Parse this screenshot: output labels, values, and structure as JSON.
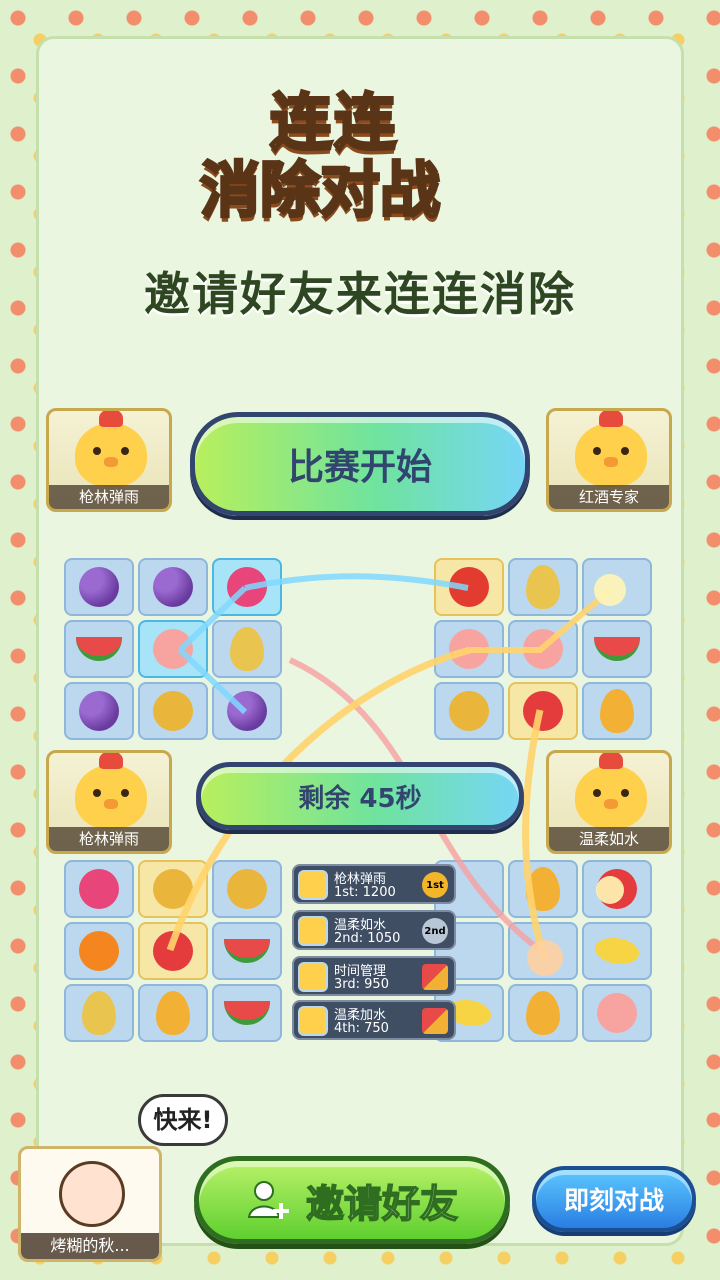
{
  "logo": {
    "line1": "连连",
    "line2a": "消除",
    "line2b": "对战"
  },
  "subtitle": "邀请好友来连连消除",
  "start_button": "比赛开始",
  "timer_button": "剩余 45秒",
  "players": {
    "top_left": "枪林弹雨",
    "top_right": "红酒专家",
    "mid_left": "枪林弹雨",
    "mid_right": "温柔如水"
  },
  "board_top_left": [
    "grapes",
    "grapes",
    "dragonfruit",
    "watermelon",
    "peach",
    "pear",
    "grapes",
    "pineapple",
    "grapes"
  ],
  "board_top_right": [
    "apple",
    "pear",
    "",
    "peach",
    "peach",
    "watermelon",
    "pineapple",
    "strawberry",
    "mango"
  ],
  "board_bottom_left": [
    "dragonfruit",
    "pineapple",
    "pineapple",
    "orange",
    "strawberry",
    "watermelon",
    "pear",
    "mango",
    "watermelon"
  ],
  "board_bottom_right": [
    "",
    "mango",
    "strawberry",
    "",
    "",
    "banana",
    "banana",
    "mango",
    "peach"
  ],
  "leaderboard": [
    {
      "name": "枪林弹雨",
      "score": "1st: 1200",
      "medal": "1st"
    },
    {
      "name": "温柔如水",
      "score": "2nd: 1050",
      "medal": "2nd"
    },
    {
      "name": "时间管理",
      "score": "3rd: 950",
      "medal": ""
    },
    {
      "name": "温柔加水",
      "score": "4th: 750",
      "medal": ""
    }
  ],
  "bubble": "快来!",
  "me_label": "烤糊的秋...",
  "invite_button": "邀请好友",
  "fight_button": "即刻对战",
  "colors": {
    "grapes": "#7b4bb5",
    "dragonfruit": "#e8457a",
    "watermelon": "#e84a4a",
    "peach": "#f7a4a0",
    "pear": "#e9c44f",
    "pineapple": "#e9b53a",
    "apple": "#e23b30",
    "strawberry": "#e43c3c",
    "mango": "#f2b134",
    "orange": "#f5861f",
    "banana": "#f7d443"
  }
}
